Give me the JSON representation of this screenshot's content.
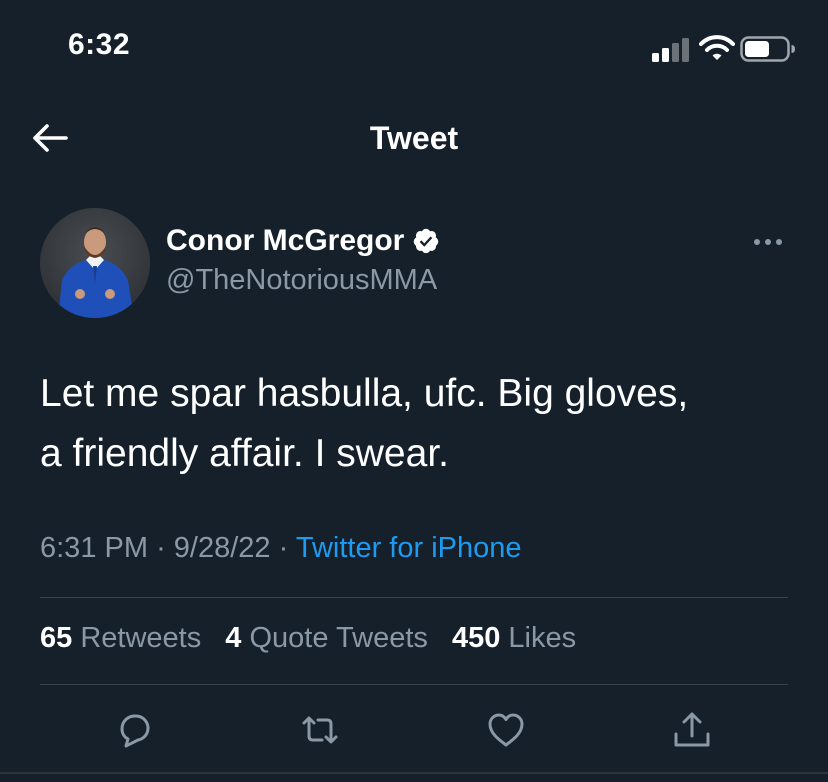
{
  "status_bar": {
    "time": "6:32"
  },
  "header": {
    "title": "Tweet"
  },
  "tweet": {
    "author_name": "Conor McGregor",
    "author_handle": "@TheNotoriousMMA",
    "verified": true,
    "text_line1": "Let me spar hasbulla, ufc. Big gloves,",
    "text_line2": "a friendly affair. I swear.",
    "time": "6:31 PM",
    "separator": "·",
    "date": "9/28/22",
    "source": "Twitter for iPhone"
  },
  "stats": {
    "retweets_count": "65",
    "retweets_label": "Retweets",
    "quotes_count": "4",
    "quotes_label": "Quote Tweets",
    "likes_count": "450",
    "likes_label": "Likes"
  },
  "actions": [
    "reply-icon",
    "retweet-icon",
    "like-icon",
    "share-icon"
  ],
  "colors": {
    "background": "#15202b",
    "text": "#ffffff",
    "secondary_text": "#8b98a5",
    "link": "#1d9bf0",
    "divider": "#38444d"
  }
}
